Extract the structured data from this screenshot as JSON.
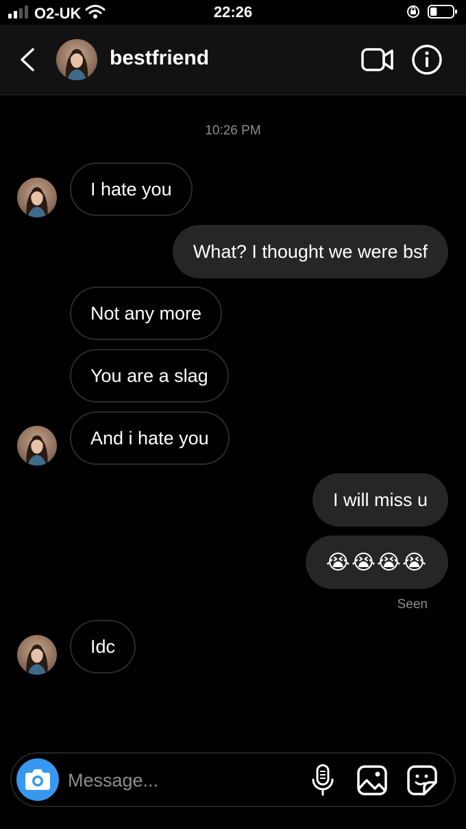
{
  "status_bar": {
    "carrier": "O2-UK",
    "time": "22:26",
    "battery_percent": 30
  },
  "header": {
    "username": "bestfriend"
  },
  "thread": {
    "timestamp": "10:26 PM",
    "messages": [
      {
        "sender": "bestfriend",
        "text": "I hate you"
      },
      {
        "sender": "me",
        "text": "What? I thought we were bsf"
      },
      {
        "sender": "bestfriend",
        "text": "Not any more"
      },
      {
        "sender": "bestfriend",
        "text": "You are a slag"
      },
      {
        "sender": "bestfriend",
        "text": "And i hate you"
      },
      {
        "sender": "me",
        "text": "I will miss u"
      },
      {
        "sender": "me",
        "text": "😭😭😭😭"
      },
      {
        "sender": "bestfriend",
        "text": "Idc"
      }
    ],
    "seen_label": "Seen"
  },
  "composer": {
    "placeholder": "Message..."
  },
  "colors": {
    "background": "#000000",
    "header": "#121212",
    "outgoing_bubble": "#262626",
    "camera_button": "#3897f0",
    "muted_text": "#8e8e8e"
  },
  "icons": [
    "signal-icon",
    "wifi-icon",
    "orientation-lock-icon",
    "battery-icon",
    "back-chevron-icon",
    "video-call-icon",
    "info-icon",
    "camera-icon",
    "microphone-icon",
    "gallery-icon",
    "sticker-icon"
  ]
}
